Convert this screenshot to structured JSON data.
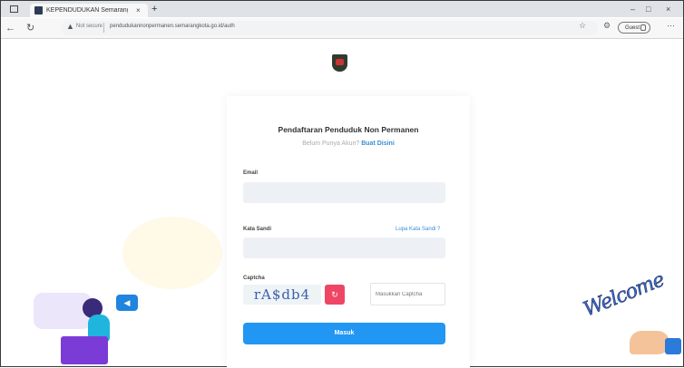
{
  "browser": {
    "tab_title": "KEPENDUDUKAN Semarang",
    "tab_close": "×",
    "new_tab": "+",
    "minimize": "–",
    "restore": "□",
    "close": "×",
    "back": "←",
    "reload": "↻",
    "not_secure": "Not secure",
    "url": "pendudukannonpermanen.semarangkota.go.id/auth",
    "guest_label": "Guest",
    "more": "⋯"
  },
  "form": {
    "title": "Pendaftaran Penduduk Non Permanen",
    "subtitle_text": "Belum Punya Akun?",
    "subtitle_link": "Buat Disini",
    "email_label": "Email",
    "password_label": "Kata Sandi",
    "forgot_link": "Lupa Kata Sandi ?",
    "captcha_label": "Captcha",
    "captcha_text": "rA$db4",
    "captcha_placeholder": "Masukkan Captcha",
    "submit_label": "Masuk"
  },
  "illustration": {
    "welcome_text": "Welcome"
  },
  "colors": {
    "accent": "#2196f3",
    "refresh": "#ef4665"
  }
}
